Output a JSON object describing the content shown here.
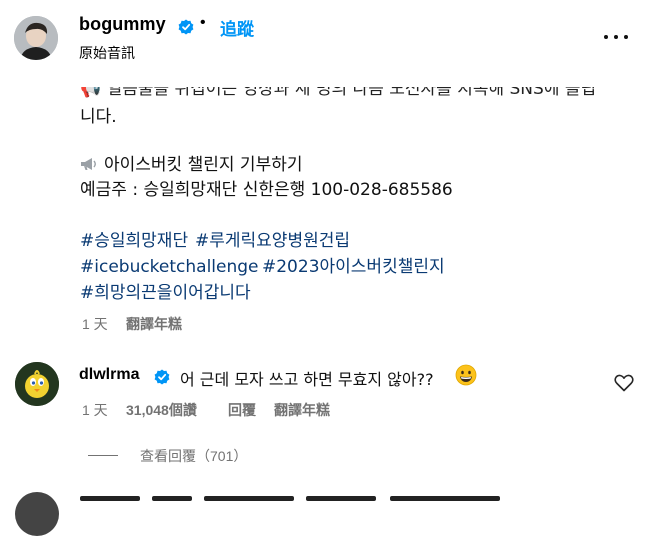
{
  "header": {
    "username": "bogummy",
    "follow_label": "追蹤",
    "dot": "•",
    "subtitle": "原始音訊",
    "verified_icon": "verified-badge-icon",
    "more_icon": "more-options-icon"
  },
  "caption": {
    "cut_line": "📢 얼음물을 뒤집어쓴 영상과 세 명의 다음 도전자를 지목해 SNS에 올립",
    "lines": [
      "니다.",
      "아이스버킷 챌린지 기부하기",
      "예금주 : 승일희망재단 신한은행 100-028-685586"
    ],
    "hashtags": [
      "#승일희망재단",
      "#루게릭요양병원건립",
      "#icebucketchallenge",
      "#2023아이스버킷챌린지",
      "#희망의끈을이어갑니다"
    ],
    "time": "1 天",
    "translate": "翻譯年糕"
  },
  "comment": {
    "username": "dlwlrma",
    "text": "어 근데 모자 쓰고 하면 무효지 않아??",
    "emoji_icon": "grinning-face-icon",
    "time": "1 天",
    "likes": "31,048個讚",
    "reply": "回覆",
    "translate": "翻譯年糕",
    "heart_icon": "heart-outline-icon",
    "view_replies": "查看回覆（701）"
  },
  "colors": {
    "accent": "#0095f6",
    "hashtag": "#0a3a73",
    "meta": "#737373"
  }
}
